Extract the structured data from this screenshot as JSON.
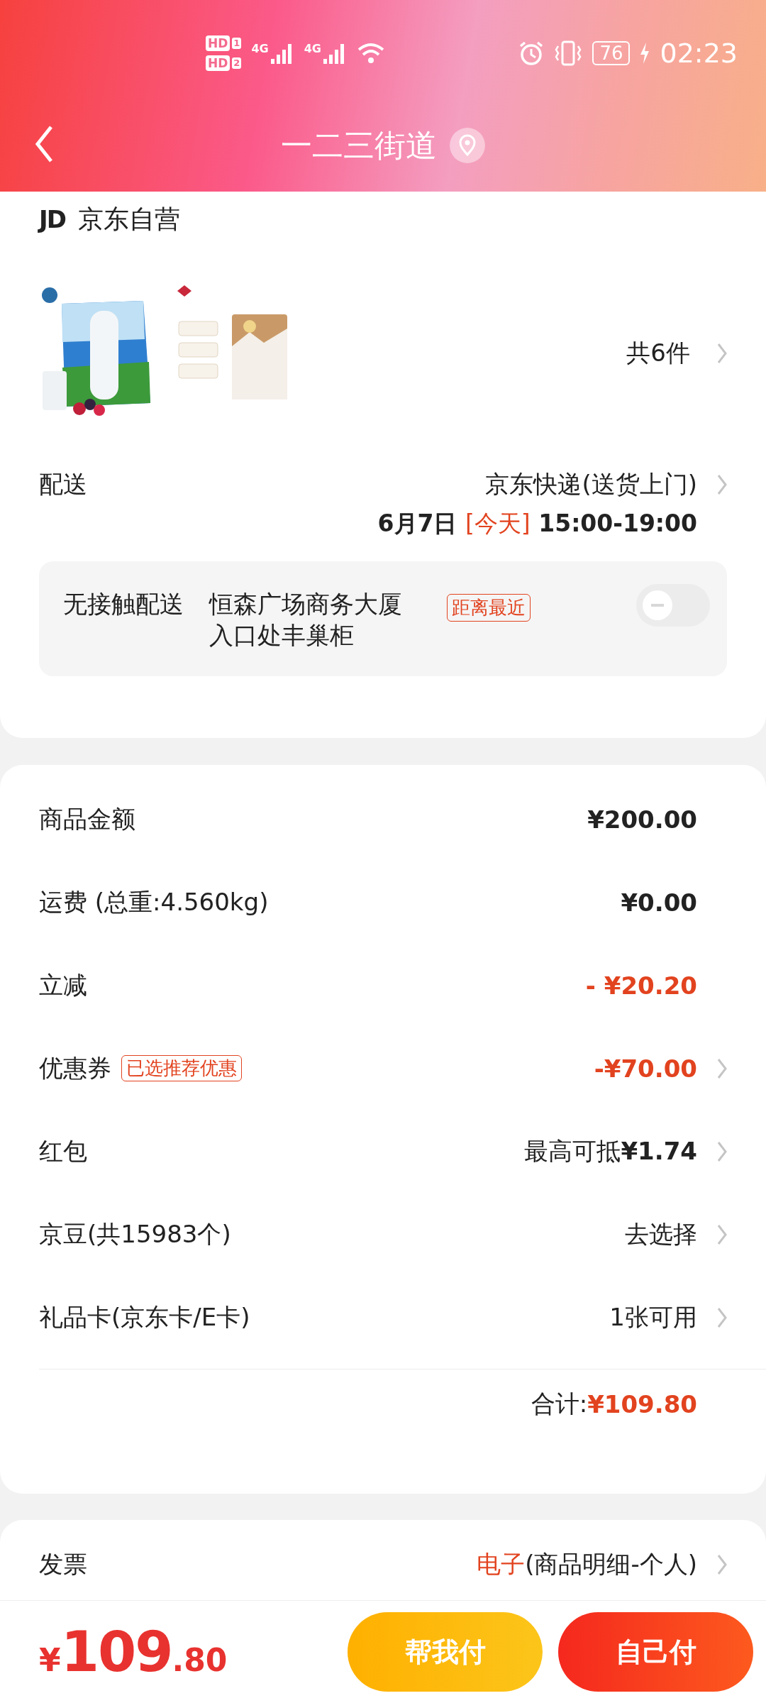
{
  "status_bar": {
    "sims": [
      {
        "label": "HD",
        "slot": "1"
      },
      {
        "label": "HD",
        "slot": "2"
      }
    ],
    "networks": [
      "4G",
      "4G"
    ],
    "battery": "76",
    "charging": true,
    "time": "02:23"
  },
  "header": {
    "title": "一二三街道"
  },
  "store": {
    "logo": "JD",
    "name": "京东自营"
  },
  "products": {
    "count": "共6件"
  },
  "delivery": {
    "label": "配送",
    "method": "京东快递(送货上门)",
    "date": "6月7日",
    "day_tag": "[今天]",
    "time": "15:00-19:00"
  },
  "contactless": {
    "label": "无接触配送",
    "location": "恒森广场商务大厦入口处丰巢柜",
    "tag": "距离最近",
    "on": false
  },
  "costs": [
    {
      "label": "商品金额",
      "value": "¥200.00",
      "highlight": false,
      "bold": true,
      "arrow": false
    },
    {
      "label": "运费 (总重:4.560kg)",
      "value": "¥0.00",
      "highlight": false,
      "bold": true,
      "arrow": false
    },
    {
      "label": "立减",
      "value": "- ¥20.20",
      "highlight": true,
      "bold": true,
      "arrow": false
    },
    {
      "label": "优惠券",
      "tag": "已选推荐优惠",
      "value": "-¥70.00",
      "highlight": true,
      "bold": true,
      "arrow": true
    },
    {
      "label": "红包",
      "value": "最高可抵**¥1.74**",
      "highlight": false,
      "bold": false,
      "arrow": true
    },
    {
      "label": "京豆(共15983个)",
      "value": "去选择",
      "highlight": false,
      "bold": false,
      "arrow": true
    },
    {
      "label": "礼品卡(京东卡/E卡)",
      "value": "1张可用",
      "highlight": false,
      "bold": false,
      "arrow": true
    }
  ],
  "total": {
    "label": "合计:",
    "value": "¥109.80"
  },
  "invoice": {
    "label": "发票",
    "type": "电子",
    "detail": "(商品明细-个人)"
  },
  "bottom_bar": {
    "currency": "¥",
    "amount": "109",
    "cents": ".80",
    "buttons": [
      {
        "label": "帮我付",
        "kind": "secondary"
      },
      {
        "label": "自己付",
        "kind": "primary"
      }
    ]
  }
}
